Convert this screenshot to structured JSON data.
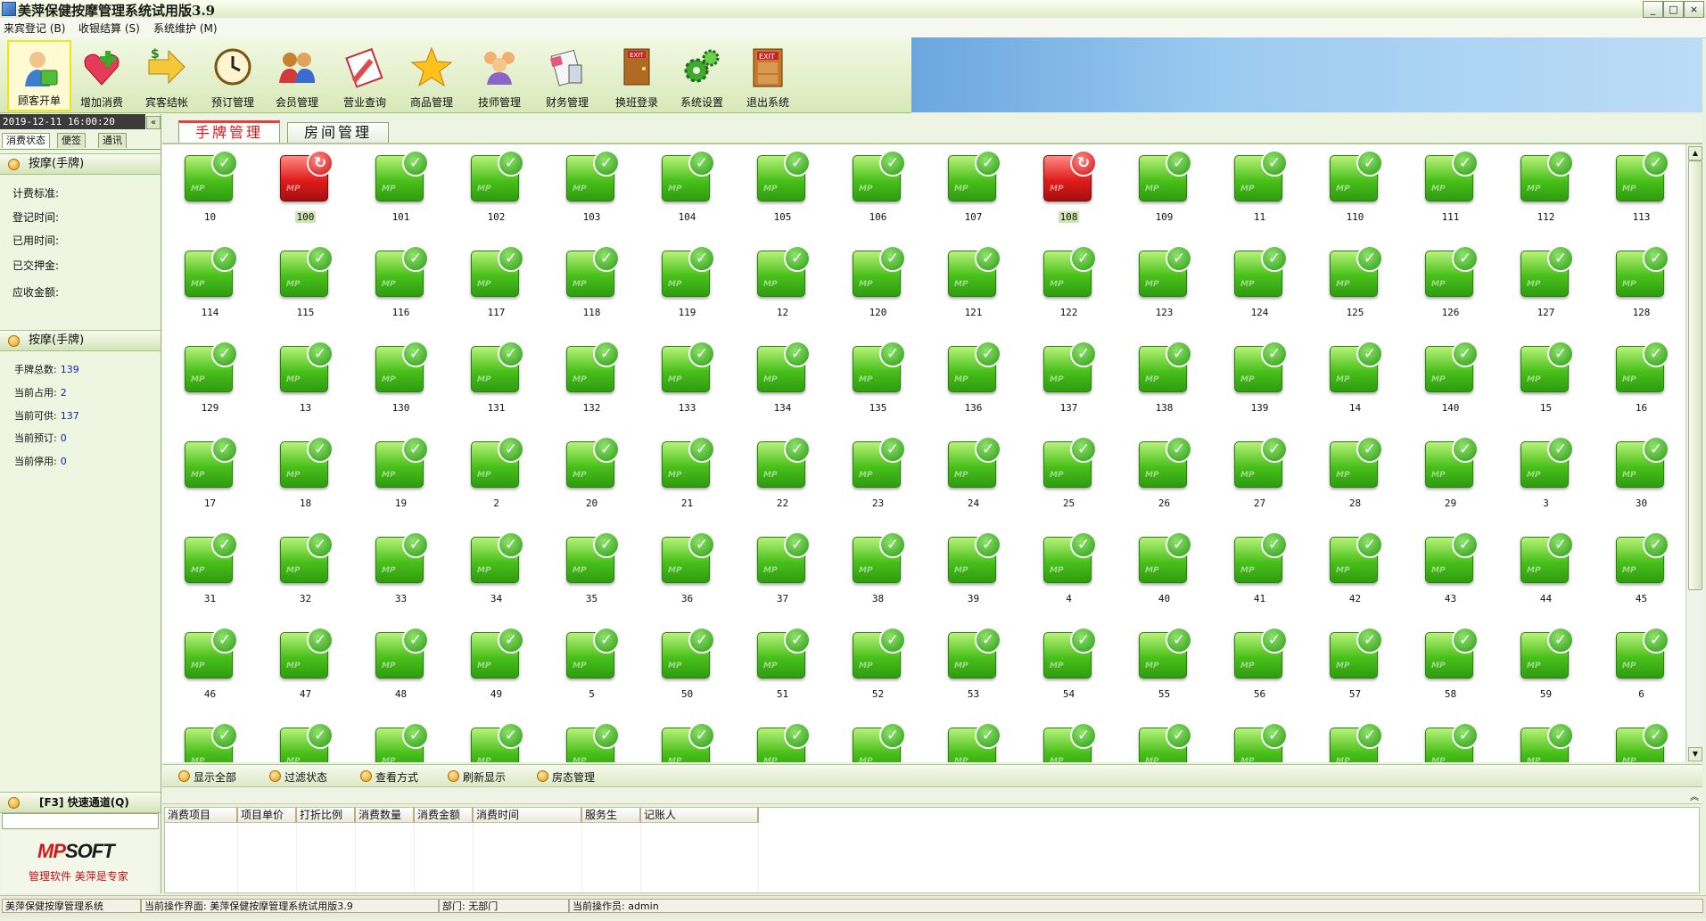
{
  "window": {
    "title": "美萍保健按摩管理系统试用版3.9",
    "minimize_glyph": "_",
    "maximize_glyph": "□",
    "close_glyph": "×"
  },
  "menubar": [
    "来宾登记 (B)",
    "收银结算 (S)",
    "系统维护 (M)"
  ],
  "toolbar": {
    "items": [
      {
        "label": "顾客开单",
        "icon": "customer-order-icon"
      },
      {
        "label": "增加消费",
        "icon": "add-consumption-icon"
      },
      {
        "label": "宾客结帐",
        "icon": "checkout-arrow-icon"
      },
      {
        "label": "预订管理",
        "icon": "clock-icon"
      },
      {
        "label": "会员管理",
        "icon": "members-icon"
      },
      {
        "label": "营业查询",
        "icon": "query-icon"
      },
      {
        "label": "商品管理",
        "icon": "star-icon"
      },
      {
        "label": "技师管理",
        "icon": "technicians-icon"
      },
      {
        "label": "财务管理",
        "icon": "calculator-icon"
      },
      {
        "label": "换班登录",
        "icon": "shift-exit-icon"
      },
      {
        "label": "系统设置",
        "icon": "gears-icon"
      },
      {
        "label": "退出系统",
        "icon": "exit-door-icon"
      }
    ],
    "active_index": 0
  },
  "left_panel": {
    "datetime": "2019-12-11 16:00:20",
    "collapse_glyph": "«",
    "tabs": [
      "消费状态",
      "便签",
      "通讯"
    ],
    "section1_title": "按摩(手牌)",
    "fields": [
      "计费标准:",
      "登记时间:",
      "已用时间:",
      "已交押金:",
      "应收金额:"
    ],
    "section2_title": "按摩(手牌)",
    "stats": [
      {
        "label": "手牌总数:",
        "value": "139"
      },
      {
        "label": "当前占用:",
        "value": "2"
      },
      {
        "label": "当前可供:",
        "value": "137"
      },
      {
        "label": "当前预订:",
        "value": "0"
      },
      {
        "label": "当前停用:",
        "value": "0"
      }
    ],
    "quick_channel": "[F3] 快速通道(Q)",
    "logo_mp": "MP",
    "logo_soft": "SOFT",
    "logo_slogan": "管理软件 美萍是专家"
  },
  "main_tabs": [
    "手牌管理",
    "房间管理"
  ],
  "rooms": [
    {
      "n": "10",
      "s": "free"
    },
    {
      "n": "100",
      "s": "busy"
    },
    {
      "n": "101",
      "s": "free"
    },
    {
      "n": "102",
      "s": "free"
    },
    {
      "n": "103",
      "s": "free"
    },
    {
      "n": "104",
      "s": "free"
    },
    {
      "n": "105",
      "s": "free"
    },
    {
      "n": "106",
      "s": "free"
    },
    {
      "n": "107",
      "s": "free"
    },
    {
      "n": "108",
      "s": "busy"
    },
    {
      "n": "109",
      "s": "free"
    },
    {
      "n": "11",
      "s": "free"
    },
    {
      "n": "110",
      "s": "free"
    },
    {
      "n": "111",
      "s": "free"
    },
    {
      "n": "112",
      "s": "free"
    },
    {
      "n": "113",
      "s": "free"
    },
    {
      "n": "114",
      "s": "free"
    },
    {
      "n": "115",
      "s": "free"
    },
    {
      "n": "116",
      "s": "free"
    },
    {
      "n": "117",
      "s": "free"
    },
    {
      "n": "118",
      "s": "free"
    },
    {
      "n": "119",
      "s": "free"
    },
    {
      "n": "12",
      "s": "free"
    },
    {
      "n": "120",
      "s": "free"
    },
    {
      "n": "121",
      "s": "free"
    },
    {
      "n": "122",
      "s": "free"
    },
    {
      "n": "123",
      "s": "free"
    },
    {
      "n": "124",
      "s": "free"
    },
    {
      "n": "125",
      "s": "free"
    },
    {
      "n": "126",
      "s": "free"
    },
    {
      "n": "127",
      "s": "free"
    },
    {
      "n": "128",
      "s": "free"
    },
    {
      "n": "129",
      "s": "free"
    },
    {
      "n": "13",
      "s": "free"
    },
    {
      "n": "130",
      "s": "free"
    },
    {
      "n": "131",
      "s": "free"
    },
    {
      "n": "132",
      "s": "free"
    },
    {
      "n": "133",
      "s": "free"
    },
    {
      "n": "134",
      "s": "free"
    },
    {
      "n": "135",
      "s": "free"
    },
    {
      "n": "136",
      "s": "free"
    },
    {
      "n": "137",
      "s": "free"
    },
    {
      "n": "138",
      "s": "free"
    },
    {
      "n": "139",
      "s": "free"
    },
    {
      "n": "14",
      "s": "free"
    },
    {
      "n": "140",
      "s": "free"
    },
    {
      "n": "15",
      "s": "free"
    },
    {
      "n": "16",
      "s": "free"
    },
    {
      "n": "17",
      "s": "free"
    },
    {
      "n": "18",
      "s": "free"
    },
    {
      "n": "19",
      "s": "free"
    },
    {
      "n": "2",
      "s": "free"
    },
    {
      "n": "20",
      "s": "free"
    },
    {
      "n": "21",
      "s": "free"
    },
    {
      "n": "22",
      "s": "free"
    },
    {
      "n": "23",
      "s": "free"
    },
    {
      "n": "24",
      "s": "free"
    },
    {
      "n": "25",
      "s": "free"
    },
    {
      "n": "26",
      "s": "free"
    },
    {
      "n": "27",
      "s": "free"
    },
    {
      "n": "28",
      "s": "free"
    },
    {
      "n": "29",
      "s": "free"
    },
    {
      "n": "3",
      "s": "free"
    },
    {
      "n": "30",
      "s": "free"
    },
    {
      "n": "31",
      "s": "free"
    },
    {
      "n": "32",
      "s": "free"
    },
    {
      "n": "33",
      "s": "free"
    },
    {
      "n": "34",
      "s": "free"
    },
    {
      "n": "35",
      "s": "free"
    },
    {
      "n": "36",
      "s": "free"
    },
    {
      "n": "37",
      "s": "free"
    },
    {
      "n": "38",
      "s": "free"
    },
    {
      "n": "39",
      "s": "free"
    },
    {
      "n": "4",
      "s": "free"
    },
    {
      "n": "40",
      "s": "free"
    },
    {
      "n": "41",
      "s": "free"
    },
    {
      "n": "42",
      "s": "free"
    },
    {
      "n": "43",
      "s": "free"
    },
    {
      "n": "44",
      "s": "free"
    },
    {
      "n": "45",
      "s": "free"
    },
    {
      "n": "46",
      "s": "free"
    },
    {
      "n": "47",
      "s": "free"
    },
    {
      "n": "48",
      "s": "free"
    },
    {
      "n": "49",
      "s": "free"
    },
    {
      "n": "5",
      "s": "free"
    },
    {
      "n": "50",
      "s": "free"
    },
    {
      "n": "51",
      "s": "free"
    },
    {
      "n": "52",
      "s": "free"
    },
    {
      "n": "53",
      "s": "free"
    },
    {
      "n": "54",
      "s": "free"
    },
    {
      "n": "55",
      "s": "free"
    },
    {
      "n": "56",
      "s": "free"
    },
    {
      "n": "57",
      "s": "free"
    },
    {
      "n": "58",
      "s": "free"
    },
    {
      "n": "59",
      "s": "free"
    },
    {
      "n": "6",
      "s": "free"
    },
    {
      "n": "",
      "s": "free"
    },
    {
      "n": "",
      "s": "free"
    },
    {
      "n": "",
      "s": "free"
    },
    {
      "n": "",
      "s": "free"
    },
    {
      "n": "",
      "s": "free"
    },
    {
      "n": "",
      "s": "free"
    },
    {
      "n": "",
      "s": "free"
    },
    {
      "n": "",
      "s": "free"
    },
    {
      "n": "",
      "s": "free"
    },
    {
      "n": "",
      "s": "free"
    },
    {
      "n": "",
      "s": "free"
    },
    {
      "n": "",
      "s": "free"
    },
    {
      "n": "",
      "s": "free"
    },
    {
      "n": "",
      "s": "free"
    },
    {
      "n": "",
      "s": "free"
    },
    {
      "n": "",
      "s": "free"
    }
  ],
  "room_tile_watermark": "MP",
  "grid_actions": [
    "显示全部",
    "过滤状态",
    "查看方式",
    "刷新显示",
    "房态管理"
  ],
  "consumption_table": {
    "columns": [
      "消费项目",
      "项目单价",
      "打折比例",
      "消费数量",
      "消费金额",
      "消费时间",
      "服务生",
      "记账人"
    ]
  },
  "statusbar": [
    "美萍保健按摩管理系统",
    "当前操作界面: 美萍保健按摩管理系统试用版3.9",
    "部门: 无部门",
    "当前操作员: admin"
  ],
  "colors": {
    "accent_green": "#49c01a",
    "busy_red": "#e01c1c",
    "tab_active": "#d21a1a",
    "stat_value": "#1a22b6"
  }
}
